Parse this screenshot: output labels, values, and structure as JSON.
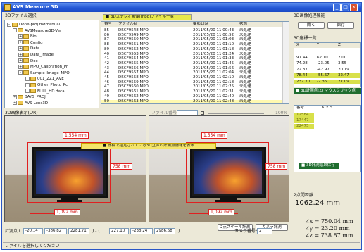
{
  "window": {
    "title": "AVS Measure 3D"
  },
  "tree": {
    "label": "3Dファイル選択",
    "items": [
      {
        "label": "Done-proj.mdmanual",
        "exp": "-"
      },
      {
        "label": "AVSMeasure3D-Ver",
        "exp": "-"
      },
      {
        "label": "Bin",
        "exp": "+"
      },
      {
        "label": "Config",
        "exp": "+"
      },
      {
        "label": "Data",
        "exp": "+"
      },
      {
        "label": "Data_image",
        "exp": "+"
      },
      {
        "label": "Doc",
        "exp": "+"
      },
      {
        "label": "MPO_Calibration_Pr",
        "exp": "+"
      },
      {
        "label": "Sample_Image_MPO",
        "exp": "-"
      },
      {
        "label": "001_ZZ1_AVE",
        "exp": ""
      },
      {
        "label": "Other_Photo_Pc",
        "exp": ""
      },
      {
        "label": "FULL_HD data",
        "exp": ""
      },
      {
        "label": "BAYS_PROJ",
        "exp": "+"
      },
      {
        "label": "AVS-Lens3D",
        "exp": "+"
      }
    ]
  },
  "file_table": {
    "banner": "■ 3Dステレオ画像(mpo)ファイル一覧",
    "headers": [
      "番号",
      "ファイル名",
      "撮影日時",
      "状態"
    ],
    "rows": [
      [
        "85",
        "DSCF9548.MPO",
        "2011/05/20 11:00:43",
        "未処理"
      ],
      [
        "86",
        "DSCF9549.MPO",
        "2011/05/20 11:00:52",
        "未処理"
      ],
      [
        "87",
        "DSCF9550.MPO",
        "2011/05/20 11:01:03",
        "未処理"
      ],
      [
        "88",
        "DSCF9551.MPO",
        "2011/05/20 11:01:10",
        "未処理"
      ],
      [
        "89",
        "DSCF9552.MPO",
        "2011/05/20 11:01:18",
        "未処理"
      ],
      [
        "40",
        "DSCF9553.MPO",
        "2011/05/20 11:01:24",
        "未処理"
      ],
      [
        "41",
        "DSCF9554.MPO",
        "2011/05/20 11:01:33",
        "未処理"
      ],
      [
        "42",
        "DSCF9555.MPO",
        "2011/05/20 11:01:45",
        "未処理"
      ],
      [
        "43",
        "DSCF9556.MPO",
        "2011/05/20 11:01:56",
        "未処理"
      ],
      [
        "44",
        "DSCF9557.MPO",
        "2011/05/20 11:02:04",
        "未処理"
      ],
      [
        "45",
        "DSCF9558.MPO",
        "2011/05/20 11:02:10",
        "未処理"
      ],
      [
        "46",
        "DSCF9559.MPO",
        "2011/05/20 11:02:18",
        "未処理"
      ],
      [
        "47",
        "DSCF9560.MPO",
        "2011/05/20 11:02:25",
        "未処理"
      ],
      [
        "48",
        "DSCF9561.MPO",
        "2011/05/20 11:02:31",
        "未処理"
      ],
      [
        "49",
        "DSCF9562.MPO",
        "2011/05/20 11:02:40",
        "未処理"
      ],
      [
        "50",
        "DSCF9563.MPO",
        "2011/05/20 11:02:48",
        "未処理"
      ]
    ]
  },
  "right_top": {
    "label": "3D画像処理機能",
    "button_left": "開く",
    "button_right": "保存",
    "coords_label": "3D座標一覧",
    "headers": [
      "X",
      "Y",
      "Z"
    ],
    "rows": [
      [
        "",
        "",
        ""
      ],
      [
        "97.44",
        "62.10",
        "2.00"
      ],
      [
        "74.28",
        "-23.05",
        "3.55"
      ],
      [
        "72.87",
        "-42.97",
        "20.19"
      ],
      [
        "78.44",
        "-55.67",
        "32.47"
      ],
      [
        "237.70",
        "-2.36",
        "27.09"
      ]
    ],
    "green_banner": "■ 3D計測点(Z) マウスクリック点"
  },
  "right_mid": {
    "headers": [
      "番号",
      "コメント"
    ],
    "rows": [
      [
        "12584",
        ""
      ],
      [
        "17447",
        ""
      ],
      [
        "22475",
        ""
      ]
    ],
    "green_button": "■ 3D計測結果保存"
  },
  "viewer": {
    "label": "3D画像表示(L/R)",
    "file_label": "ファイル番号",
    "frame_value": "",
    "zoom_label": "100%",
    "center_banner": "■ 赤枠で指定されている3D立体の計測点情報を表示"
  },
  "measurements": {
    "left": {
      "width": "1,554 mm",
      "height": "758 mm",
      "bottom": "1,092 mm"
    },
    "right": {
      "width": "1,554 mm",
      "height": "758 mm",
      "bottom": "1,092 mm"
    }
  },
  "toolbar_bottom": {
    "coord_label": "計測点 (",
    "values": [
      "-20.14",
      "-386.82",
      "2281.71",
      "227.10",
      "-238.24",
      "2986.68"
    ],
    "sep": ") - (",
    "end": ")",
    "button_a": "2点スケール計測",
    "button_b": "カメラ計測",
    "camera_label": "カメラ番号",
    "camera_value": "2"
  },
  "distance": {
    "label": "2点間距離",
    "value": "1062.24 mm",
    "dx": "∠x = 750.04 mm",
    "dy": "∠y = 23.20 mm",
    "dz": "∠z = 738.87 mm"
  },
  "status": {
    "text": "ファイルを選択してください"
  },
  "colors": {
    "measure_red": "#e02020",
    "highlight_yellow": "#d8e04a",
    "banner_green": "#1f6d2e"
  }
}
